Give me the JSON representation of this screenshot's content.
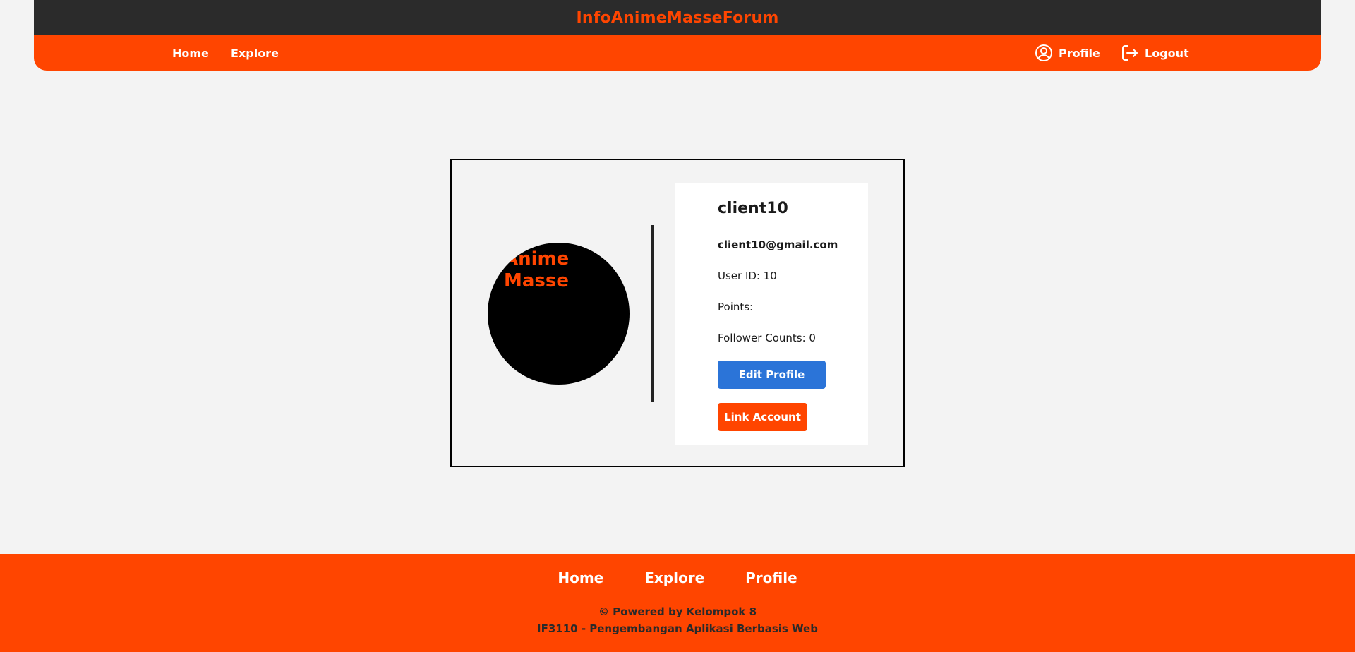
{
  "header": {
    "brand": "InfoAnimeMasseForum",
    "nav_left": [
      {
        "label": "Home"
      },
      {
        "label": "Explore"
      }
    ],
    "nav_right": {
      "profile": {
        "label": "Profile",
        "icon": "user-circle-icon"
      },
      "logout": {
        "label": "Logout",
        "icon": "logout-icon"
      }
    }
  },
  "profile": {
    "avatar_text": "Anime\nMasse",
    "username": "client10",
    "email": "client10@gmail.com",
    "user_id": "User ID: 10",
    "points": "Points:",
    "followers": "Follower Counts: 0",
    "edit_button": "Edit Profile",
    "link_button": "Link Account"
  },
  "footer": {
    "links": [
      {
        "label": "Home"
      },
      {
        "label": "Explore"
      },
      {
        "label": "Profile"
      }
    ],
    "credit_line1": "© Powered by Kelompok 8",
    "credit_line2": "IF3110 - Pengembangan Aplikasi Berbasis Web"
  },
  "colors": {
    "accent": "#ff4500",
    "header_dark": "#2b2b2b",
    "button_blue": "#2b74d8",
    "background": "#f3f3f3"
  }
}
